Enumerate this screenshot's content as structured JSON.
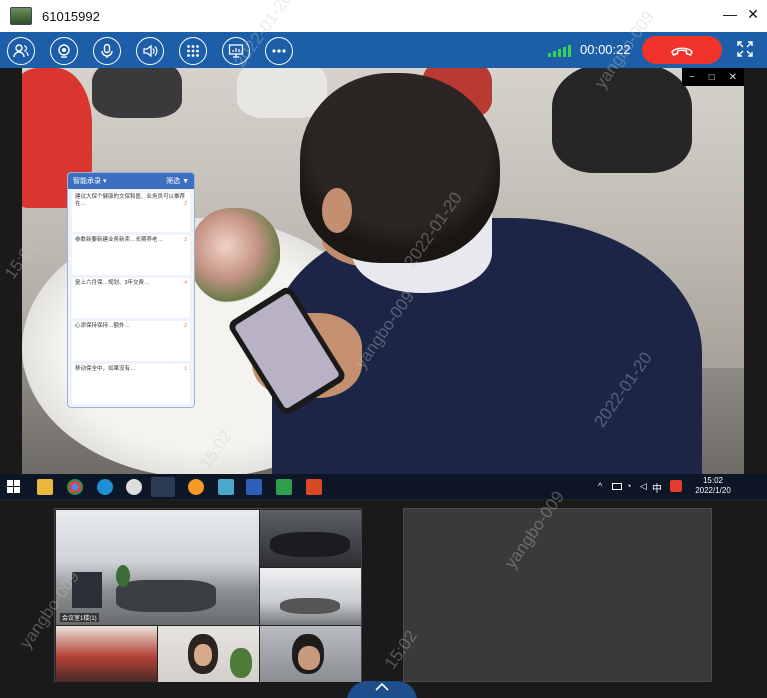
{
  "window": {
    "title": "61015992",
    "minimize_glyph": "—",
    "close_glyph": "✕"
  },
  "toolbar": {
    "tools": [
      {
        "name": "participants",
        "icon": "person-icon"
      },
      {
        "name": "camera",
        "icon": "camera-icon"
      },
      {
        "name": "microphone",
        "icon": "microphone-icon"
      },
      {
        "name": "speaker",
        "icon": "speaker-icon"
      },
      {
        "name": "apps",
        "icon": "grid-icon"
      },
      {
        "name": "share-screen",
        "icon": "screen-share-icon"
      },
      {
        "name": "more",
        "icon": "more-icon"
      }
    ],
    "signal_color": "#35d35a",
    "call_timer": "00:00:22",
    "hangup_color": "#f2332c",
    "expand_icon": "fullscreen-icon"
  },
  "main_video": {
    "overlay_controls": [
      "−",
      "□",
      "✕"
    ],
    "chat_panel": {
      "header_left": "智能承录 ▾",
      "header_right": "筛选 ▼",
      "messages": [
        {
          "text": "建议大保个健康的文保和医、业务员可以推荐在…",
          "stat": "2"
        },
        {
          "text": "参数新要新建业务新卖…长期养老…",
          "stat": "3"
        },
        {
          "text": "复上六月保…规划、3年交费…",
          "stat": "4"
        },
        {
          "text": "心添保持保持…额外…",
          "stat": "2"
        },
        {
          "text": "移动保全中，如果没有…",
          "stat": "1"
        }
      ]
    },
    "taskbar": {
      "tray_time": "15:02",
      "tray_date": "2022/1/20",
      "ime": "中"
    }
  },
  "gallery": {
    "tiles": [
      {
        "label": "会议室1楼(1)"
      },
      {
        "label": ""
      },
      {
        "label": ""
      },
      {
        "label": ""
      },
      {
        "label": ""
      },
      {
        "label": ""
      }
    ]
  },
  "watermark": {
    "text": "yangbo-009",
    "date": "2022-01-20",
    "time": "15:02"
  }
}
